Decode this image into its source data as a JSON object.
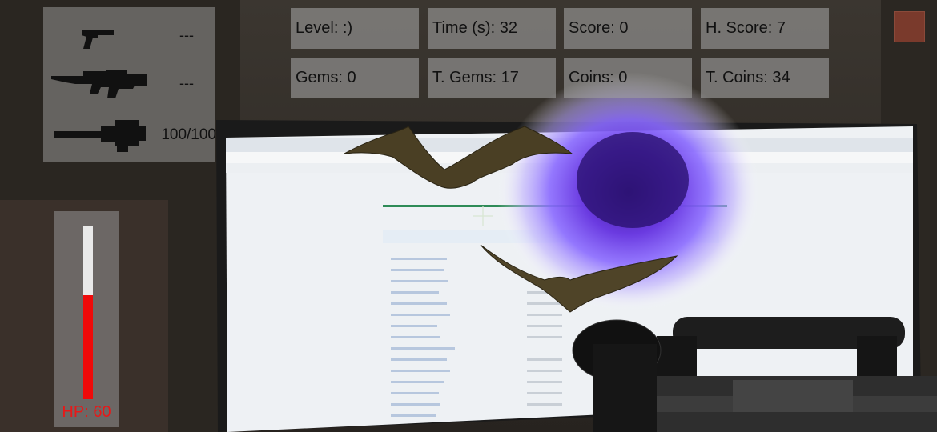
{
  "weapons": [
    {
      "name": "pistol-icon",
      "ammo": "---"
    },
    {
      "name": "rifle-icon",
      "ammo": "---"
    },
    {
      "name": "minigun-icon",
      "ammo": "100/100"
    }
  ],
  "stats": {
    "level": "Level: :)",
    "time": "Time (s): 32",
    "score": "Score: 0",
    "high_score": "H. Score: 7",
    "gems": "Gems: 0",
    "total_gems": "T. Gems: 17",
    "coins": "Coins: 0",
    "total_coins": "T. Coins: 34"
  },
  "health": {
    "label": "HP: 60",
    "value": 60,
    "max": 100
  },
  "colors": {
    "hp_fill": "#ee0a0a",
    "hp_text": "#e81818",
    "pause_button": "#7a3a2c"
  }
}
